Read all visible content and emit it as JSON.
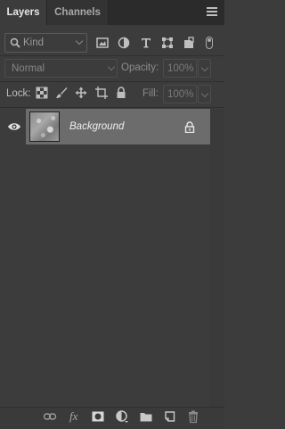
{
  "tabs": [
    {
      "label": "Layers",
      "active": true
    },
    {
      "label": "Channels",
      "active": false
    }
  ],
  "filter": {
    "kind_label": "Kind",
    "icons": [
      "image-filter-icon",
      "adjustment-filter-icon",
      "type-filter-icon",
      "shape-filter-icon",
      "smart-object-filter-icon"
    ]
  },
  "blend": {
    "mode": "Normal",
    "opacity_label": "Opacity:",
    "opacity_value": "100%"
  },
  "lock": {
    "label": "Lock:",
    "fill_label": "Fill:",
    "fill_value": "100%"
  },
  "layers": [
    {
      "name": "Background",
      "visible": true,
      "locked": true,
      "selected": true
    }
  ],
  "bottom_icons": [
    "link-layers-icon",
    "fx-icon",
    "add-mask-icon",
    "new-fill-adjustment-icon",
    "new-group-icon",
    "new-layer-icon",
    "delete-layer-icon"
  ],
  "colors": {
    "panel": "#3c3c3c",
    "selected_row": "#6c6c6c",
    "tabbar": "#2b2b2b"
  }
}
